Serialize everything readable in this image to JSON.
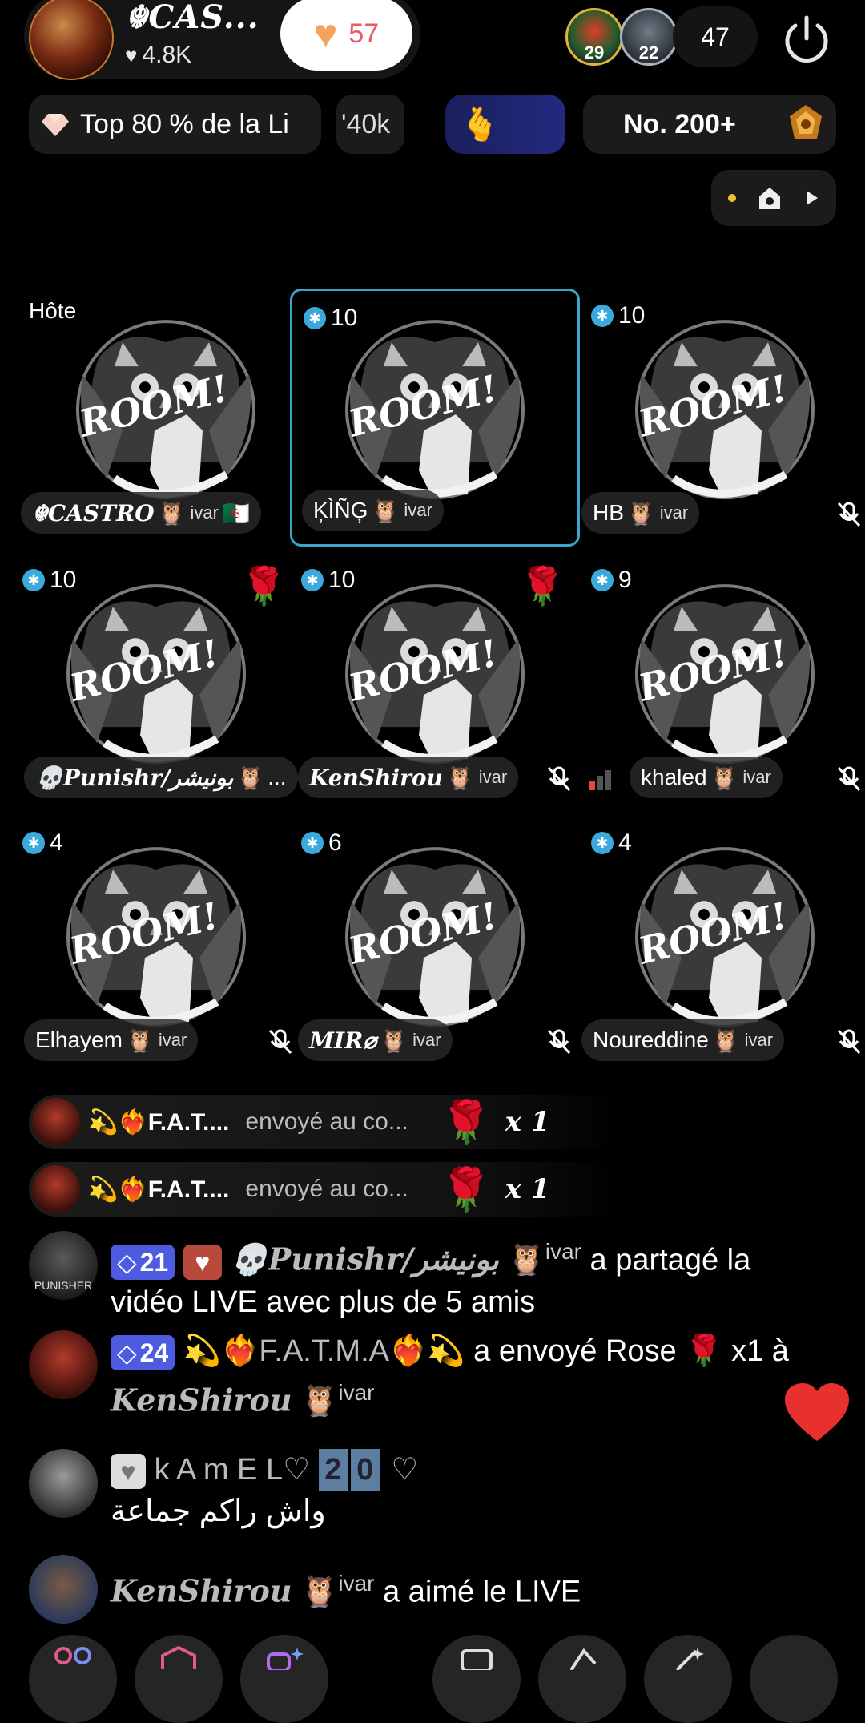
{
  "header": {
    "host_name": "☬CAS...",
    "host_likes": "4.8K",
    "follow_count": "57",
    "viewer_badges": [
      "29",
      "22"
    ],
    "viewer_count": "47"
  },
  "ranking": {
    "league_text": "Top 80 % de la Li",
    "scroll_text": "'40k",
    "rank_text": "No. 200+"
  },
  "seats": [
    {
      "top_label": "Hôte",
      "name": "☬CASTRO",
      "suffix": "ivar",
      "flag": "🇩🇿",
      "rose": false,
      "muted": false
    },
    {
      "level": "10",
      "name": "ĶÌÑĢ",
      "suffix": "ivar",
      "rose": false,
      "muted": false,
      "active": true
    },
    {
      "level": "10",
      "name": "HB",
      "suffix": "ivar",
      "rose": false,
      "muted": true
    },
    {
      "level": "10",
      "name": "💀Punishr/بونيشر",
      "suffix": "...",
      "rose": true,
      "muted": false
    },
    {
      "level": "10",
      "name": "KenShirou",
      "suffix": "ivar",
      "rose": true,
      "muted": true
    },
    {
      "level": "9",
      "name": "khaled",
      "suffix": "ivar",
      "rose": false,
      "muted": true
    },
    {
      "level": "4",
      "name": "Elhayem",
      "suffix": "ivar",
      "rose": false,
      "muted": true
    },
    {
      "level": "6",
      "name": "MIR⌀",
      "suffix": "ivar",
      "rose": false,
      "muted": true
    },
    {
      "level": "4",
      "name": "Noureddine",
      "suffix": "ivar",
      "rose": false,
      "muted": true
    }
  ],
  "seat_image_text": "ROOM!",
  "gifts": [
    {
      "sender": "💫❤️‍🔥F.A.T....",
      "action": "envoyé au co...",
      "gift": "🌹",
      "multiplier": "x 1"
    },
    {
      "sender": "💫❤️‍🔥F.A.T....",
      "action": "envoyé au co...",
      "gift": "🌹",
      "multiplier": "x 1"
    }
  ],
  "chat": [
    {
      "level": "21",
      "user": "💀Punishr/بونيشر",
      "suffix": "ivar",
      "text": " a partagé la vidéo LIVE avec plus de 5 amis"
    },
    {
      "level": "24",
      "user": "💫❤️‍🔥F.A.T.M.A❤️‍🔥💫",
      "text": " a envoyé Rose 🌹 x1 à ",
      "target": "KenShirou",
      "target_suffix": "ivar"
    },
    {
      "user": "k A m E L♡",
      "digits": [
        "2",
        "0"
      ],
      "user_tail": "♡",
      "text": "واش راكم جماعة"
    },
    {
      "user": "KenShirou",
      "suffix": "ivar",
      "text": " a aimé le LIVE"
    }
  ],
  "avatar_caption": "PUNISHER",
  "colors": {
    "background": "#000000",
    "accent_blue": "#39a6c9",
    "level_badge": "#4d5be0",
    "heart_red": "#e8302f",
    "follow_count": "#ec5a63"
  }
}
